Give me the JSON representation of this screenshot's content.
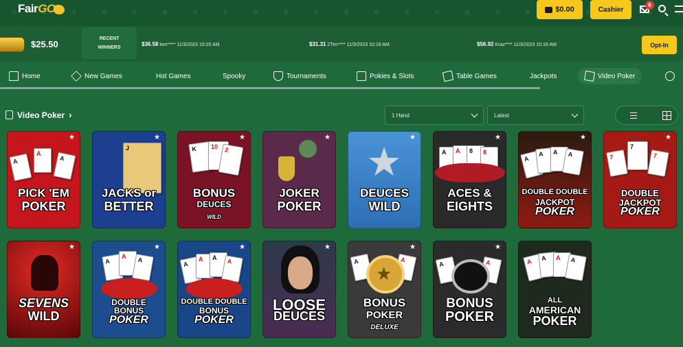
{
  "header": {
    "logo_text": "Fair",
    "logo_go": "GO",
    "balance": "$0.00",
    "cashier_label": "Cashier",
    "mail_count": "6"
  },
  "winners_bar": {
    "jackpot_amount": "$25.50",
    "recent_label_1": "RECENT",
    "recent_label_2": "WINNERS",
    "items": [
      {
        "amount": "$36.58",
        "user": "kerr****",
        "time": "11/3/2023 10:20 AM"
      },
      {
        "amount": "$31.31",
        "user": "2Tim****",
        "time": "11/3/2023 10:18 AM"
      },
      {
        "amount": "$56.92",
        "user": "Kraz****",
        "time": "11/3/2023 10:16 AM"
      }
    ],
    "optin_label": "Opt-In"
  },
  "nav": {
    "items": [
      {
        "label": "Home"
      },
      {
        "label": "New Games"
      },
      {
        "label": "Hot Games"
      },
      {
        "label": "Spooky"
      },
      {
        "label": "Tournaments"
      },
      {
        "label": "Pokies & Slots"
      },
      {
        "label": "Table Games"
      },
      {
        "label": "Jackpots"
      },
      {
        "label": "Video Poker"
      }
    ]
  },
  "section": {
    "title": "Video Poker",
    "hands_select": "1 Hand",
    "sort_select": "Latest"
  },
  "games": [
    {
      "line1": "PICK 'EM",
      "line2": "POKER",
      "line3": "",
      "bg": "#c4161c"
    },
    {
      "line1": "JACKS or",
      "line2": "BETTER",
      "line3": "",
      "bg": "#1d3f8f"
    },
    {
      "line1": "BONUS",
      "line2": "DEUCES",
      "line3": "WILD",
      "bg": "#7b1326"
    },
    {
      "line1": "JOKER",
      "line2": "POKER",
      "line3": "",
      "bg": "#5b2a4a"
    },
    {
      "line1": "DEUCES",
      "line2": "WILD",
      "line3": "",
      "bg": "#3a86c9"
    },
    {
      "line1": "ACES &",
      "line2": "EIGHTS",
      "line3": "",
      "bg": "#2a2a2a"
    },
    {
      "line1": "DOUBLE DOUBLE",
      "line2": "JACKPOT",
      "line3": "POKER",
      "bg": "#8f1b12"
    },
    {
      "line1": "DOUBLE",
      "line2": "JACKPOT",
      "line3": "POKER",
      "bg": "#a51a14"
    },
    {
      "line1": "SEVENS",
      "line2": "WILD",
      "line3": "",
      "bg": "#b01b1b"
    },
    {
      "line1": "DOUBLE",
      "line2": "BONUS",
      "line3": "POKER",
      "bg": "#1d4c8f"
    },
    {
      "line1": "DOUBLE DOUBLE",
      "line2": "BONUS",
      "line3": "POKER",
      "bg": "#1a4687"
    },
    {
      "line1": "LOOSE",
      "line2": "DEUCES",
      "line3": "",
      "bg": "#4a2c52"
    },
    {
      "line1": "BONUS",
      "line2": "POKER",
      "line3": "DELUXE",
      "bg": "#3a3a3a"
    },
    {
      "line1": "BONUS",
      "line2": "POKER",
      "line3": "",
      "bg": "#2b2b2b"
    },
    {
      "line1": "ALL",
      "line2": "AMERICAN",
      "line3": "POKER",
      "bg": "#1f2a1f"
    }
  ]
}
